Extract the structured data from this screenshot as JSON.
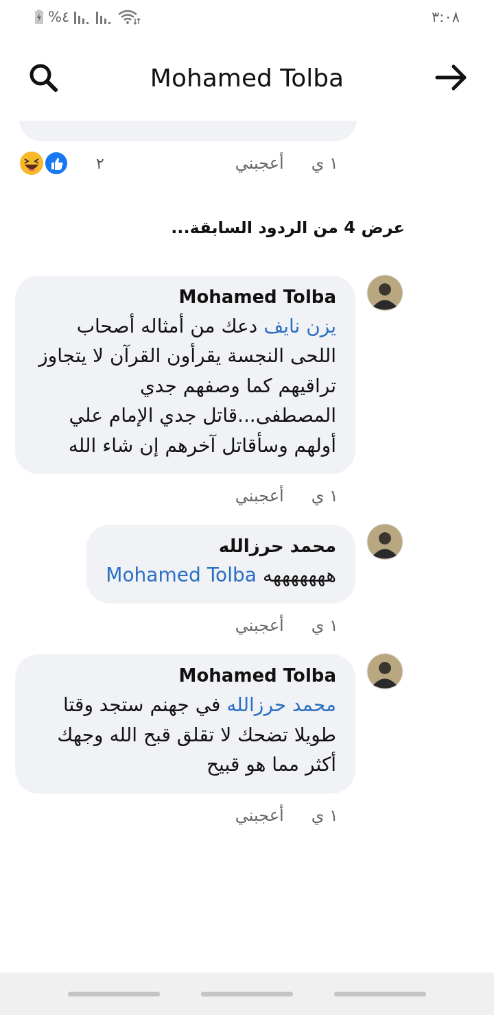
{
  "status_bar": {
    "battery": "%٤",
    "time": "٣:٠٨"
  },
  "header": {
    "title": "Mohamed Tolba"
  },
  "previous_comment": {
    "time": "١ ي",
    "like": "أعجبني",
    "reaction_count": "٢"
  },
  "load_more": "عرض 4 من الردود السابقة...",
  "comments": [
    {
      "author": "Mohamed Tolba",
      "body": [
        {
          "kind": "mention",
          "text": "يزن نايف"
        },
        {
          "kind": "text",
          "text": " دعك من أمثاله أصحاب اللحى النجسة يقرأون القرآن لا يتجاوز تراقيهم كما وصفهم جدي المصطفى...قاتل جدي الإمام علي أولهم وسأقاتل آخرهم إن شاء الله"
        }
      ],
      "time": "١ ي",
      "like": "أعجبني"
    },
    {
      "author": "محمد حرزالله",
      "body": [
        {
          "kind": "text",
          "text": "هههههههه "
        },
        {
          "kind": "mention",
          "text": "Mohamed Tolba"
        }
      ],
      "time": "١ ي",
      "like": "أعجبني"
    },
    {
      "author": "Mohamed Tolba",
      "body": [
        {
          "kind": "mention",
          "text": "محمد حرزالله"
        },
        {
          "kind": "text",
          "text": " في جهنم ستجد وقتا طويلا تضحك لا تقلق قبح الله وجهك أكثر مما هو قبيح"
        }
      ],
      "time": "١ ي",
      "like": "أعجبني"
    }
  ]
}
